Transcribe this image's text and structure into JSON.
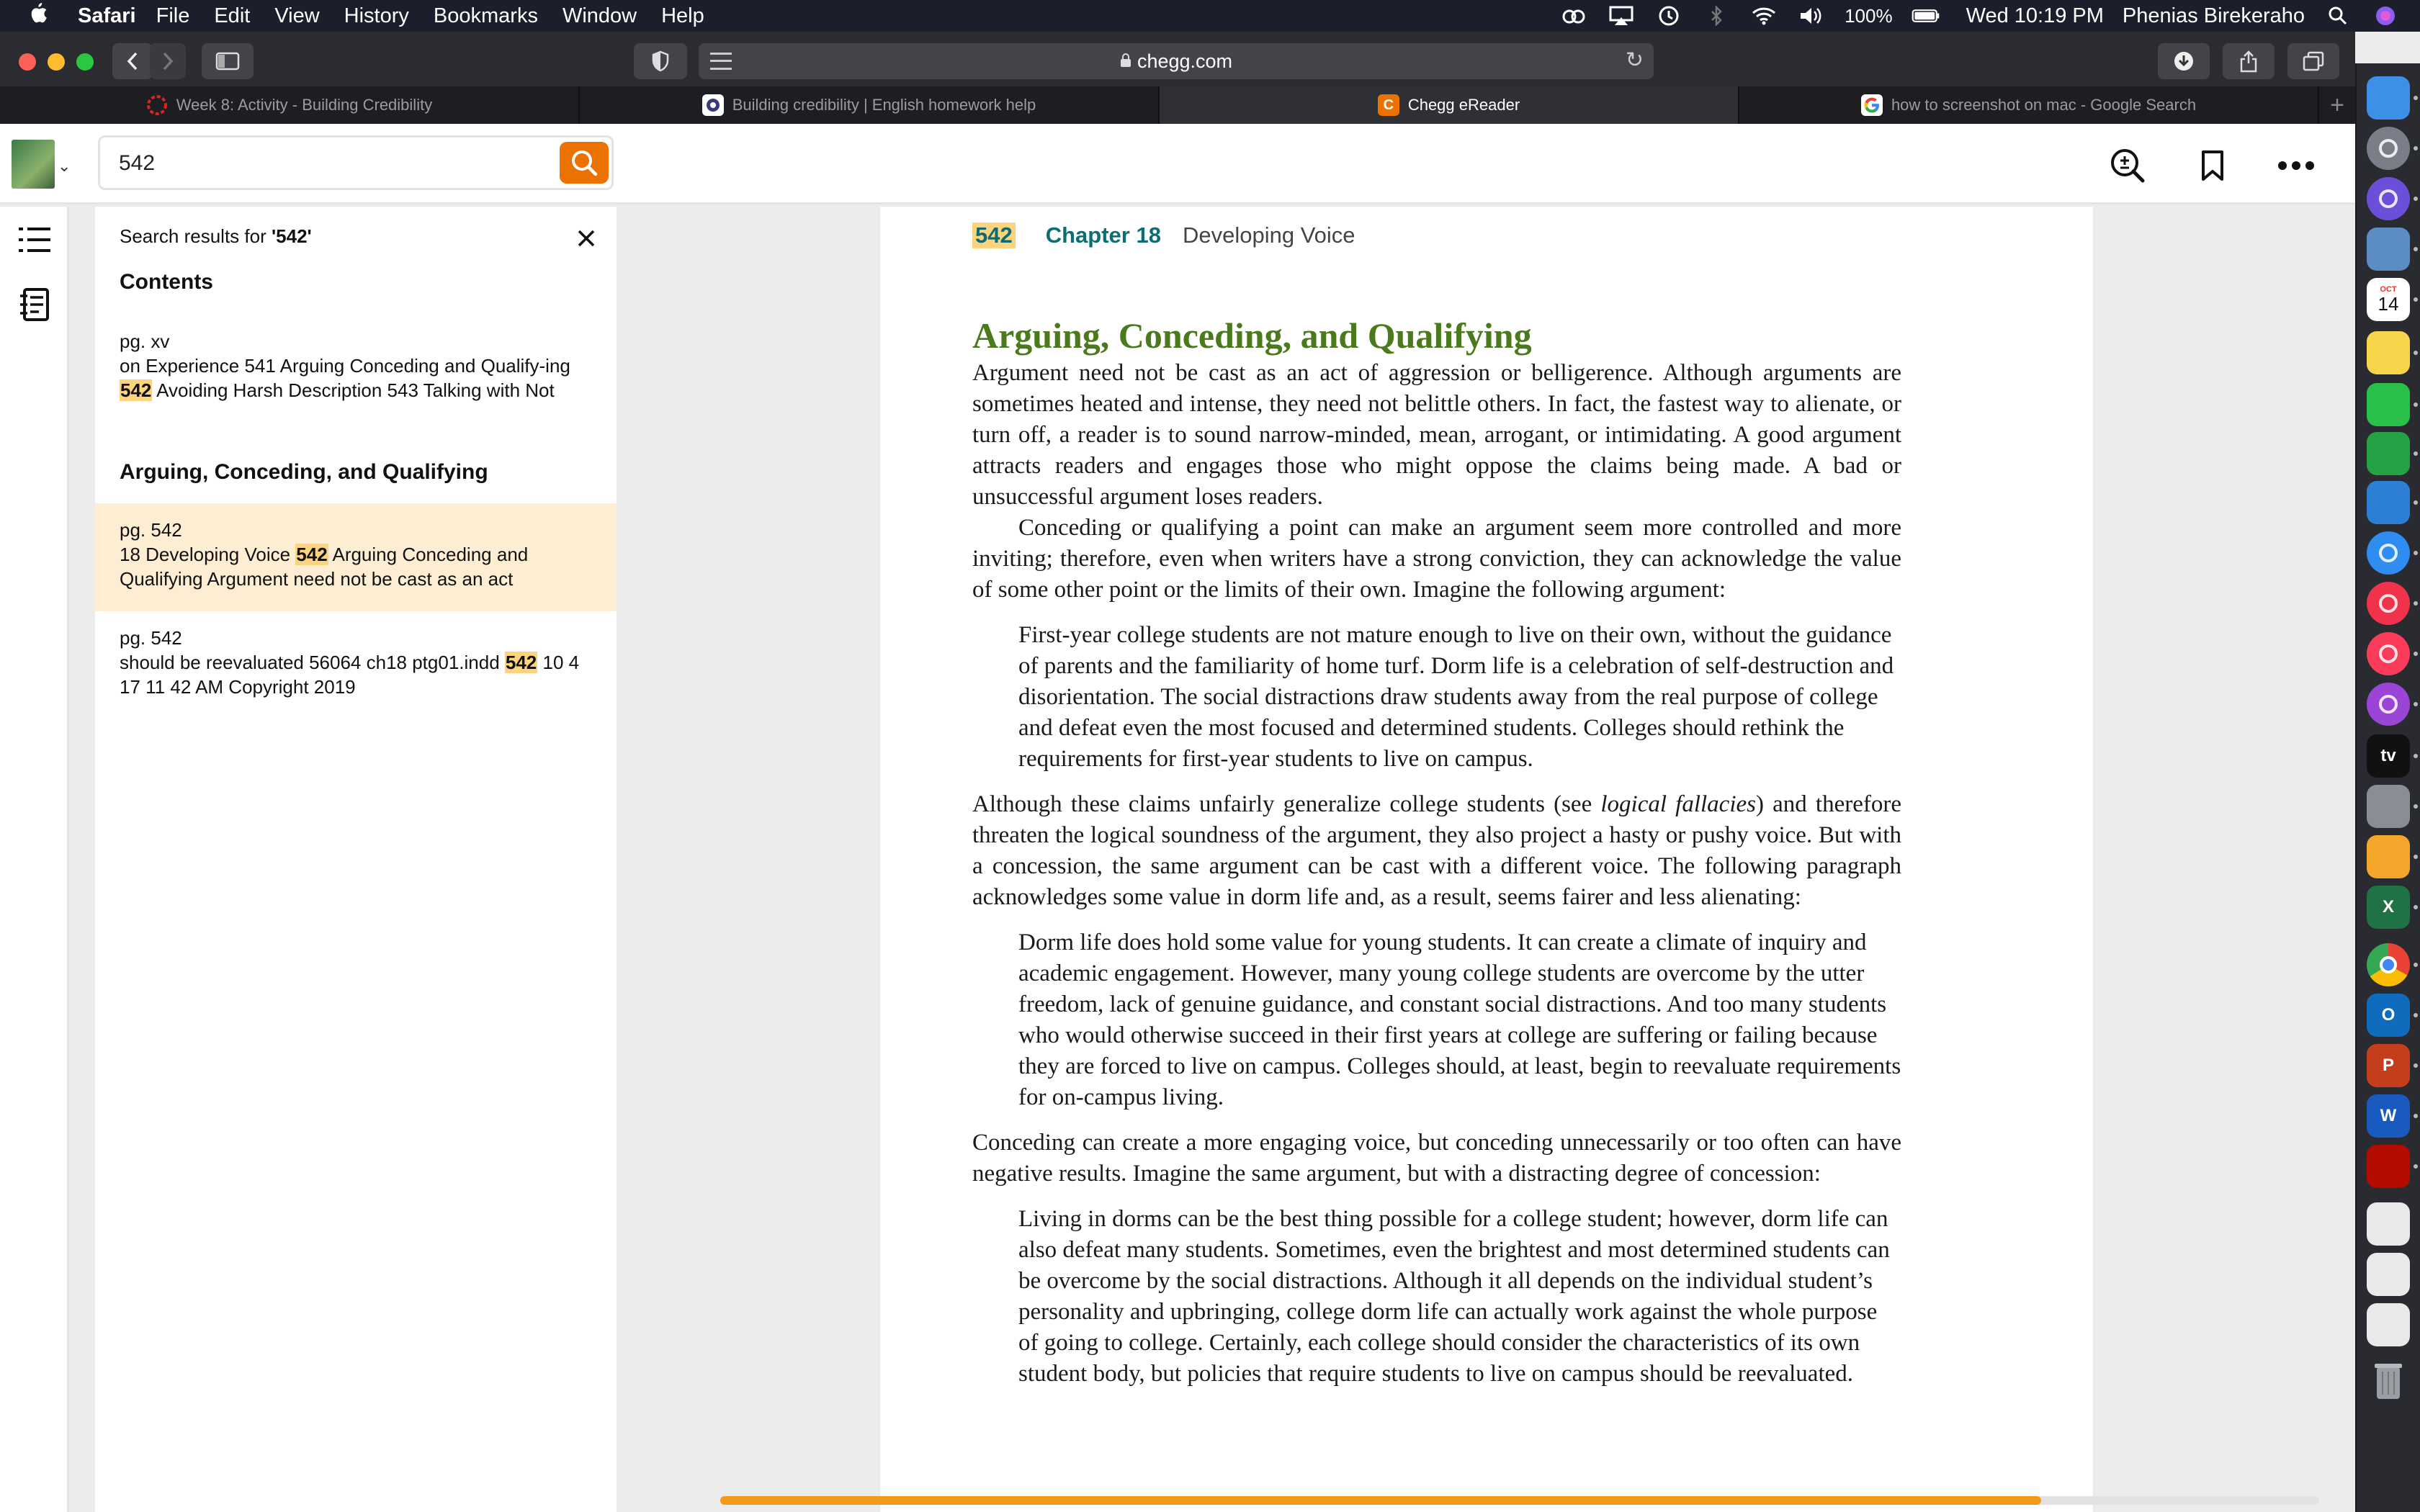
{
  "menubar": {
    "app_name": "Safari",
    "menus": [
      "File",
      "Edit",
      "View",
      "History",
      "Bookmarks",
      "Window",
      "Help"
    ],
    "battery": "100%",
    "datetime": "Wed 10:19 PM",
    "user": "Phenias Birekeraho"
  },
  "browser": {
    "url": "chegg.com",
    "tabs": [
      {
        "title": "Week 8: Activity - Building Credibility",
        "icon": "canvas-icon",
        "color": "#d2281e"
      },
      {
        "title": "Building credibility | English homework help",
        "icon": "site-icon",
        "color": "#3a3a7a"
      },
      {
        "title": "Chegg eReader",
        "icon": "chegg-icon",
        "color": "#eb7100"
      },
      {
        "title": "how to screenshot on mac - Google Search",
        "icon": "google-icon",
        "color": "#4285f4"
      }
    ],
    "active_tab": 2
  },
  "reader": {
    "search_value": "542",
    "results_label": "Search results for ",
    "results_query": "'542'",
    "contents_heading": "Contents",
    "section_heading": "Arguing, Conceding, and Qualifying",
    "results": [
      {
        "page": "pg. xv",
        "before": "on Experience 541 Arguing Conceding and Qualify-ing ",
        "match": "542",
        "after": " Avoiding Harsh Description 543 Talking with Not"
      },
      {
        "page": "pg. 542",
        "before": "18 Developing Voice ",
        "match": "542",
        "after": " Arguing Conceding and Qualifying Argument need not be cast as an act"
      },
      {
        "page": "pg. 542",
        "before": "should be reevaluated 56064 ch18 ptg01.indd ",
        "match": "542",
        "after": " 10 4 17 11 42 AM Copyright 2019"
      }
    ],
    "progress": 0.826
  },
  "page": {
    "number": "542",
    "chapter": "Chapter 18",
    "chapter_title": "Developing Voice",
    "section_title": "Arguing, Conceding, and Qualifying",
    "p1": "Argument need not be cast as an act of aggression or belligerence. Although arguments are sometimes heated and intense, they need not belittle others. In fact, the fastest way to alienate, or turn off, a reader is to sound narrow-minded, mean, arrogant, or intimidating. A good argument attracts readers and engages those who might oppose the claims being made. A bad or unsuccessful argument loses readers.",
    "p2": "Conceding or qualifying a point can make an argument seem more controlled and more inviting; therefore, even when writers have a strong conviction, they can acknowledge the value of some other point or the limits of their own. Imagine the following argument:",
    "q1": "First-year college students are not mature enough to live on their own, without the guidance of parents and the familiarity of home turf. Dorm life is a celebration of self-destruction and disorientation. The social distractions draw students away from the real purpose of college and defeat even the most focused and determined students. Colleges should rethink the requirements for first-year students to live on campus.",
    "p3_before": "Although these claims unfairly generalize college students (see ",
    "p3_italic": "logical fallacies",
    "p3_after": ") and therefore threaten the logical soundness of the argument, they also project a hasty or pushy voice. But with a concession, the same argument can be cast with a different voice. The following paragraph acknowledges some value in dorm life and, as a result, seems fairer and less alienating:",
    "q2": "Dorm life does hold some value for young students. It can create a climate of inquiry and academic engagement. However, many young college students are overcome by the utter freedom, lack of genuine guidance, and constant social distractions. And too many students who would otherwise succeed in their first years at college are suffering or failing because they are forced to live on campus. Colleges should, at least, begin to reevaluate requirements for on-campus living.",
    "p4": "Conceding can create a more engaging voice, but conceding unnecessarily or too often can have negative results. Imagine the same argument, but with a distracting degree of concession:",
    "q3": "Living in dorms can be the best thing possible for a college student; however, dorm life can also defeat many students. Sometimes, even the brightest and most determined students can be overcome by the social distractions. Although it all depends on the individual student’s personality and upbringing, college dorm life can actually work against the whole purpose of going to college. Certainly, each college should consider the characteristics of its own student body, but policies that require students to live on campus should be reevaluated."
  },
  "dock": {
    "calendar_month": "OCT",
    "calendar_day": "14",
    "apps": [
      {
        "name": "finder-icon",
        "color": "#3d8fe8"
      },
      {
        "name": "launchpad-icon",
        "color": "#7a7e88"
      },
      {
        "name": "siri-icon",
        "color": "#6b4fd8"
      },
      {
        "name": "preview-icon",
        "color": "#5b8dc4"
      },
      {
        "name": "calendar-icon",
        "color": "#ffffff"
      },
      {
        "name": "notes-icon",
        "color": "#f7d64b"
      },
      {
        "name": "facetime-icon",
        "color": "#29c04a"
      },
      {
        "name": "numbers-icon",
        "color": "#25a244"
      },
      {
        "name": "keynote-icon",
        "color": "#2d7fd6"
      },
      {
        "name": "safari-icon",
        "color": "#2f8cf0"
      },
      {
        "name": "news-icon",
        "color": "#f0334b"
      },
      {
        "name": "music-icon",
        "color": "#fa3c5a"
      },
      {
        "name": "podcasts-icon",
        "color": "#9b45d6"
      },
      {
        "name": "appletv-icon",
        "color": "#111111"
      },
      {
        "name": "system-preferences-icon",
        "color": "#8a8d94"
      },
      {
        "name": "photos-icon",
        "color": "#f4a62a"
      },
      {
        "name": "excel-icon",
        "color": "#1f7244"
      },
      {
        "name": "chrome-icon",
        "color": "#e8eaed"
      },
      {
        "name": "outlook-icon",
        "color": "#0f6cbd"
      },
      {
        "name": "powerpoint-icon",
        "color": "#c43e1c"
      },
      {
        "name": "word-icon",
        "color": "#185abd"
      },
      {
        "name": "acrobat-icon",
        "color": "#b30b00"
      },
      {
        "name": "document-thumb-icon",
        "color": "#e9e9e9"
      },
      {
        "name": "document-thumb-icon",
        "color": "#e9e9e9"
      },
      {
        "name": "document-thumb-icon",
        "color": "#e9e9e9"
      },
      {
        "name": "trash-icon",
        "color": "#8d9096"
      }
    ],
    "excel_letter": "X",
    "outlook_letter": "O",
    "powerpoint_letter": "P",
    "word_letter": "W",
    "appletv_label": "tv"
  }
}
